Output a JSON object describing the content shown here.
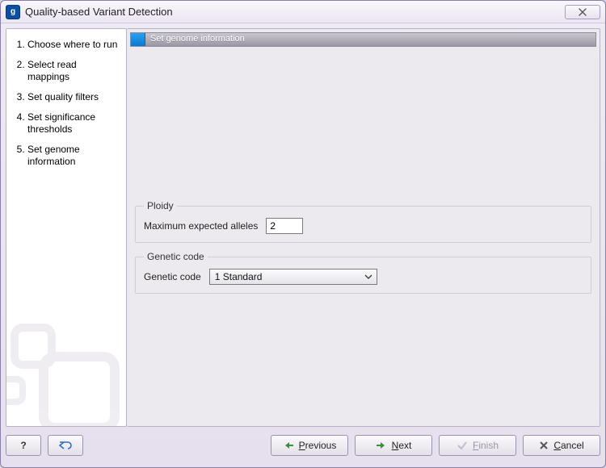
{
  "window": {
    "title": "Quality-based Variant Detection",
    "app_icon_glyph": "g"
  },
  "sidebar": {
    "steps": [
      "Choose where to run",
      "Select read mappings",
      "Set quality filters",
      "Set significance thresholds",
      "Set genome information"
    ]
  },
  "main": {
    "step_title": "Set genome information",
    "ploidy": {
      "legend": "Ploidy",
      "max_alleles_label": "Maximum expected alleles",
      "max_alleles_value": "2"
    },
    "genetic_code": {
      "legend": "Genetic code",
      "label": "Genetic code",
      "selected": "1 Standard"
    }
  },
  "footer": {
    "help_label": "?",
    "previous": "Previous",
    "next": "Next",
    "finish": "Finish",
    "cancel": "Cancel"
  }
}
